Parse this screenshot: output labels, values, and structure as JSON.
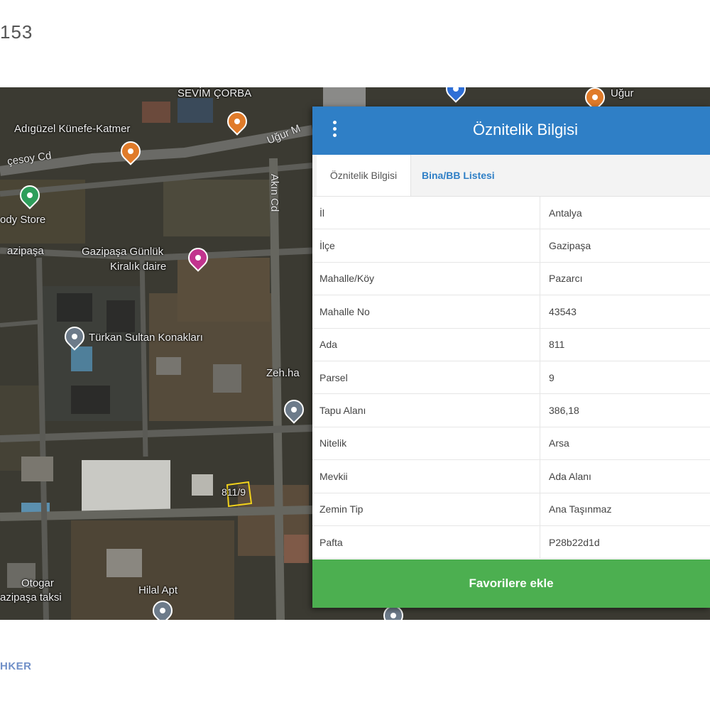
{
  "page": {
    "top_text": "153",
    "bottom_text": "HKER"
  },
  "map": {
    "labels": {
      "adiguzel": "Adıgüzel Künefe-Katmer",
      "sevim": "SEVİM ÇORBA",
      "cesoy": "çesoy Cd",
      "ugur": "Uğur M",
      "akin": "Akın Cd",
      "body_store": "ody Store",
      "gazipasa_left": "azipaşa",
      "gunluk": "Gazipaşa Günlük",
      "kiralik": "Kiralık daire",
      "turkan": "Türkan Sultan Konakları",
      "zehra": "Zeh.ha",
      "parcel": "811/9",
      "otogar": "Otogar",
      "taksi": "azipaşa taksi",
      "hilal": "Hilal Apt",
      "ugur_right": "Uğur"
    }
  },
  "panel": {
    "title": "Öznitelik Bilgisi",
    "tabs": {
      "active": "Öznitelik Bilgisi",
      "inactive": "Bina/BB Listesi"
    },
    "rows": [
      {
        "key": "İl",
        "value": "Antalya"
      },
      {
        "key": "İlçe",
        "value": "Gazipaşa"
      },
      {
        "key": "Mahalle/Köy",
        "value": "Pazarcı"
      },
      {
        "key": "Mahalle No",
        "value": "43543"
      },
      {
        "key": "Ada",
        "value": "811"
      },
      {
        "key": "Parsel",
        "value": "9"
      },
      {
        "key": "Tapu Alanı",
        "value": "386,18"
      },
      {
        "key": "Nitelik",
        "value": "Arsa"
      },
      {
        "key": "Mevkii",
        "value": "Ada Alanı"
      },
      {
        "key": "Zemin Tip",
        "value": "Ana Taşınmaz"
      },
      {
        "key": "Pafta",
        "value": "P28b22d1d"
      }
    ],
    "favorite_button": "Favorilere ekle"
  },
  "colors": {
    "header": "#2f7fc6",
    "button": "#4caf50",
    "poi_orange": "#e07b2a",
    "poi_green": "#2e9e5b",
    "poi_pink": "#c2348e",
    "poi_gray": "#6d7b8a"
  }
}
